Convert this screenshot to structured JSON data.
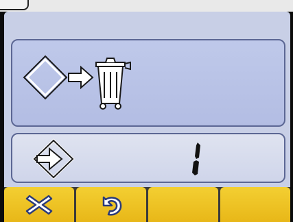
{
  "display": {
    "counter_value": "1"
  },
  "icons": {
    "storage_to_bin": "storage-to-waste-bin-icon",
    "storage_entry": "storage-entry-icon"
  },
  "softkeys": [
    {
      "name": "cancel",
      "icon": "close-icon"
    },
    {
      "name": "back",
      "icon": "undo-icon"
    },
    {
      "name": "empty-3",
      "icon": ""
    },
    {
      "name": "empty-4",
      "icon": ""
    }
  ],
  "colors": {
    "screen_bg": "#c8cfe6",
    "panel_border": "#5c6794",
    "softkey_yellow": "#f0c628"
  }
}
